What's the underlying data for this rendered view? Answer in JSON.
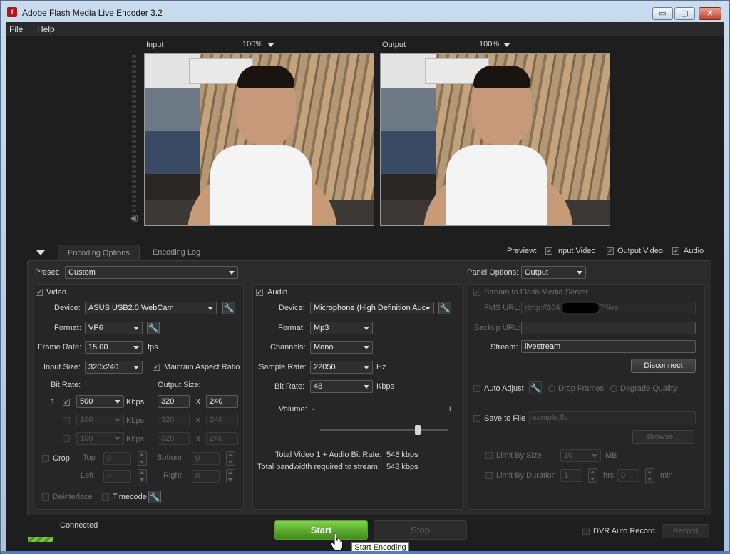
{
  "window": {
    "title": "Adobe Flash Media Live Encoder 3.2",
    "app_icon": "flash-app-icon",
    "minimize": "▭",
    "maximize": "▢",
    "close": "✕"
  },
  "menu": {
    "file": "File",
    "help": "Help"
  },
  "preview": {
    "input_label": "Input",
    "input_zoom": "100%",
    "output_label": "Output",
    "output_zoom": "100%",
    "preview_label": "Preview:",
    "input_video": "Input Video",
    "output_video": "Output Video",
    "audio": "Audio"
  },
  "tabs": {
    "encoding_options": "Encoding Options",
    "encoding_log": "Encoding Log"
  },
  "preset": {
    "label": "Preset:",
    "value": "Custom"
  },
  "panel_options": {
    "label": "Panel Options:",
    "value": "Output"
  },
  "video": {
    "label": "Video",
    "device_label": "Device:",
    "device": "ASUS USB2.0 WebCam",
    "format_label": "Format:",
    "format": "VP6",
    "frame_rate_label": "Frame Rate:",
    "frame_rate": "15.00",
    "fps": "fps",
    "input_size_label": "Input Size:",
    "input_size": "320x240",
    "maintain_aspect": "Maintain Aspect Ratio",
    "bit_rate_label": "Bit Rate:",
    "output_size_label": "Output Size:",
    "rows": [
      {
        "index": "1",
        "bitrate": "500",
        "unit": "Kbps",
        "w": "320",
        "x": "x",
        "h": "240"
      },
      {
        "index": "",
        "bitrate": "100",
        "unit": "Kbps",
        "w": "320",
        "x": "x",
        "h": "240"
      },
      {
        "index": "",
        "bitrate": "100",
        "unit": "Kbps",
        "w": "320",
        "x": "x",
        "h": "240"
      }
    ],
    "crop": "Crop",
    "top": "Top",
    "bottom": "Bottom",
    "left": "Left",
    "right": "Right",
    "crop_top": "0",
    "crop_bottom": "0",
    "crop_left": "0",
    "crop_right": "0",
    "deinterlace": "Deinterlace",
    "timecode": "Timecode"
  },
  "audio": {
    "label": "Audio",
    "device_label": "Device:",
    "device": "Microphone (High Definition Auc",
    "format_label": "Format:",
    "format": "Mp3",
    "channels_label": "Channels:",
    "channels": "Mono",
    "sample_rate_label": "Sample Rate:",
    "sample_rate": "22050",
    "hz": "Hz",
    "bit_rate_label": "Bit Rate:",
    "bit_rate": "48",
    "kbps": "Kbps",
    "volume_label": "Volume:",
    "vol_minus": "-",
    "vol_plus": "+",
    "volume_level": 0.76
  },
  "totals": {
    "total_label": "Total Video 1 + Audio Bit Rate:",
    "total_value": "548 kbps",
    "bandwidth_label": "Total bandwidth required to stream:",
    "bandwidth_value": "548 kbps"
  },
  "server": {
    "stream_to_fms": "Stream to Flash Media Server",
    "fms_url_label": "FMS URL:",
    "fms_url": "rtmp://104",
    "fms_url_tail": "7/live",
    "backup_url_label": "Backup URL:",
    "backup_url": "",
    "stream_label": "Stream:",
    "stream": "livestream",
    "disconnect": "Disconnect",
    "auto_adjust": "Auto Adjust",
    "drop_frames": "Drop Frames",
    "degrade_quality": "Degrade Quality",
    "save_to_file": "Save to File",
    "file_name": "sample.flv",
    "browse": "Browse...",
    "limit_by_size": "Limit By Size",
    "size_value": "10",
    "mb": "MB",
    "limit_by_duration": "Limit By Duration",
    "hrs_value": "1",
    "hrs": "hrs",
    "min_value": "0",
    "min": "min"
  },
  "status": {
    "connected": "Connected",
    "start": "Start",
    "stop": "Stop",
    "dvr_auto_record": "DVR Auto Record",
    "record": "Record",
    "tooltip": "Start Encoding"
  }
}
